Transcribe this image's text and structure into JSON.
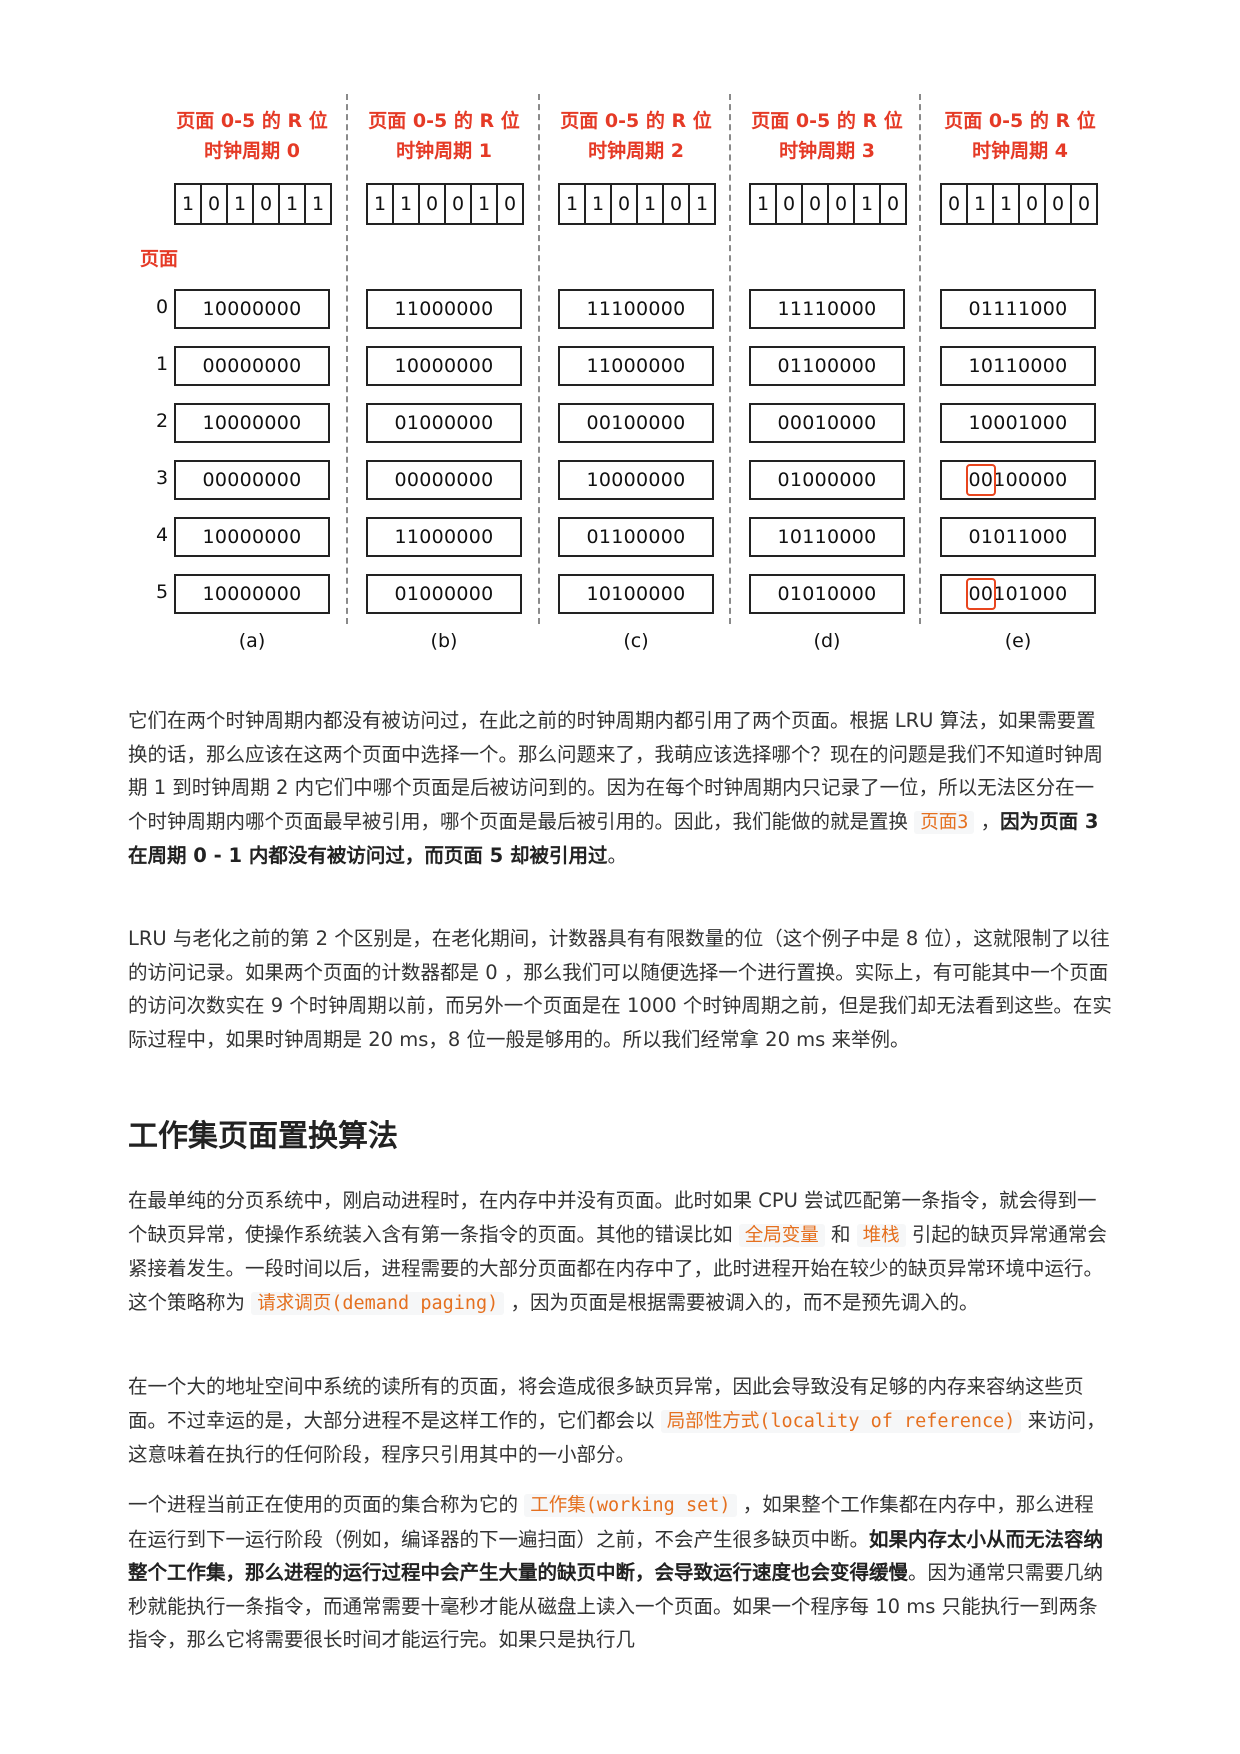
{
  "figure": {
    "columns": [
      {
        "title1": "页面 0-5 的 R 位",
        "title2": "时钟周期 0",
        "rbits": [
          "1",
          "0",
          "1",
          "0",
          "1",
          "1"
        ],
        "counters": [
          "10000000",
          "00000000",
          "10000000",
          "00000000",
          "10000000",
          "10000000"
        ],
        "caption": "(a)"
      },
      {
        "title1": "页面 0-5 的 R 位",
        "title2": "时钟周期 1",
        "rbits": [
          "1",
          "1",
          "0",
          "0",
          "1",
          "0"
        ],
        "counters": [
          "11000000",
          "10000000",
          "01000000",
          "00000000",
          "11000000",
          "01000000"
        ],
        "caption": "(b)"
      },
      {
        "title1": "页面 0-5 的 R 位",
        "title2": "时钟周期 2",
        "rbits": [
          "1",
          "1",
          "0",
          "1",
          "0",
          "1"
        ],
        "counters": [
          "11100000",
          "11000000",
          "00100000",
          "10000000",
          "01100000",
          "10100000"
        ],
        "caption": "(c)"
      },
      {
        "title1": "页面 0-5 的 R 位",
        "title2": "时钟周期 3",
        "rbits": [
          "1",
          "0",
          "0",
          "0",
          "1",
          "0"
        ],
        "counters": [
          "11110000",
          "01100000",
          "00010000",
          "01000000",
          "10110000",
          "01010000"
        ],
        "caption": "(d)"
      },
      {
        "title1": "页面 0-5 的 R 位",
        "title2": "时钟周期 4",
        "rbits": [
          "0",
          "1",
          "1",
          "0",
          "0",
          "0"
        ],
        "counters": [
          "01111000",
          "10110000",
          "10001000",
          "00100000",
          "01011000",
          "00101000"
        ],
        "caption": "(e)"
      }
    ],
    "page_axis_label": "页面",
    "row_indices": [
      "0",
      "1",
      "2",
      "3",
      "4",
      "5"
    ],
    "highlight_color": "#e8451e"
  },
  "p1": {
    "t1": "它们在两个时钟周期内都没有被访问过，在此之前的时钟周期内都引用了两个页面。根据 LRU 算法，如果需要置换的话，那么应该在这两个页面中选择一个。那么问题来了，我萌应该选择哪个？现在的问题是我们不知道时钟周期 1 到时钟周期 2 内它们中哪个页面是后被访问到的。因为在每个时钟周期内只记录了一位，所以无法区分在一个时钟周期内哪个页面最早被引用，哪个页面是最后被引用的。因此，我们能做的就是置换",
    "code1": "页面3",
    "t2": "，",
    "bold1": "因为页面 3 在周期 0 - 1 内都没有被访问过，而页面 5 却被引用过",
    "t3": "。"
  },
  "p2": {
    "t1": "LRU 与老化之前的第 2 个区别是，在老化期间，计数器具有有限数量的位（这个例子中是 8 位），这就限制了以往的访问记录。如果两个页面的计数器都是 0 ，那么我们可以随便选择一个进行置换。实际上，有可能其中一个页面的访问次数实在 9 个时钟周期以前，而另外一个页面是在 1000 个时钟周期之前，但是我们却无法看到这些。在实际过程中，如果时钟周期是 20 ms，8 位一般是够用的。所以我们经常拿 20 ms 来举例。"
  },
  "h2": "工作集页面置换算法",
  "p3": {
    "t1": "在最单纯的分页系统中，刚启动进程时，在内存中并没有页面。此时如果 CPU 尝试匹配第一条指令，就会得到一个缺页异常，使操作系统装入含有第一条指令的页面。其他的错误比如",
    "code1": "全局变量",
    "t2": "和",
    "code2": "堆栈",
    "t3": "引起的缺页异常通常会紧接着发生。一段时间以后，进程需要的大部分页面都在内存中了，此时进程开始在较少的缺页异常环境中运行。这个策略称为",
    "code3": "请求调页(demand paging)",
    "t4": "，因为页面是根据需要被调入的，而不是预先调入的。"
  },
  "p4": {
    "t1": "在一个大的地址空间中系统的读所有的页面，将会造成很多缺页异常，因此会导致没有足够的内存来容纳这些页面。不过幸运的是，大部分进程不是这样工作的，它们都会以",
    "code1": "局部性方式(locality of reference)",
    "t2": "来访问，这意味着在执行的任何阶段，程序只引用其中的一小部分。"
  },
  "p5": {
    "t1": "一个进程当前正在使用的页面的集合称为它的",
    "code1": "工作集(working set)",
    "t2": "，如果整个工作集都在内存中，那么进程在运行到下一运行阶段（例如，编译器的下一遍扫面）之前，不会产生很多缺页中断。",
    "bold1": "如果内存太小从而无法容纳整个工作集，那么进程的运行过程中会产生大量的缺页中断，会导致运行速度也会变得缓慢",
    "t3": "。因为通常只需要几纳秒就能执行一条指令，而通常需要十毫秒才能从磁盘上读入一个页面。如果一个程序每 10 ms 只能执行一到两条指令，那么它将需要很长时间才能运行完。如果只是执行几"
  }
}
